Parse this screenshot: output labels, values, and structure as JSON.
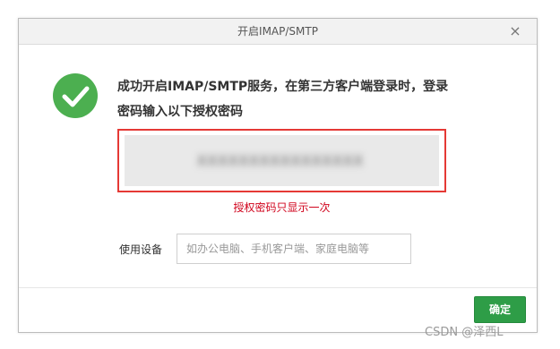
{
  "dialog": {
    "title": "开启IMAP/SMTP",
    "close_glyph": "×",
    "message": "成功开启IMAP/SMTP服务，在第三方客户端登录时，登录密码输入以下授权密码",
    "code": "XXXXXXXXXXXXXXXX",
    "hint": "授权密码只显示一次",
    "device_label": "使用设备",
    "device_placeholder": "如办公电脑、手机客户端、家庭电脑等",
    "confirm_label": "确定"
  },
  "colors": {
    "success": "#4caf50",
    "highlight_border": "#e53935",
    "hint_text": "#d0021b",
    "button": "#2e9d47"
  },
  "icons": {
    "success": "check-circle-icon",
    "close": "close-icon"
  },
  "watermark": "CSDN @泽西L"
}
